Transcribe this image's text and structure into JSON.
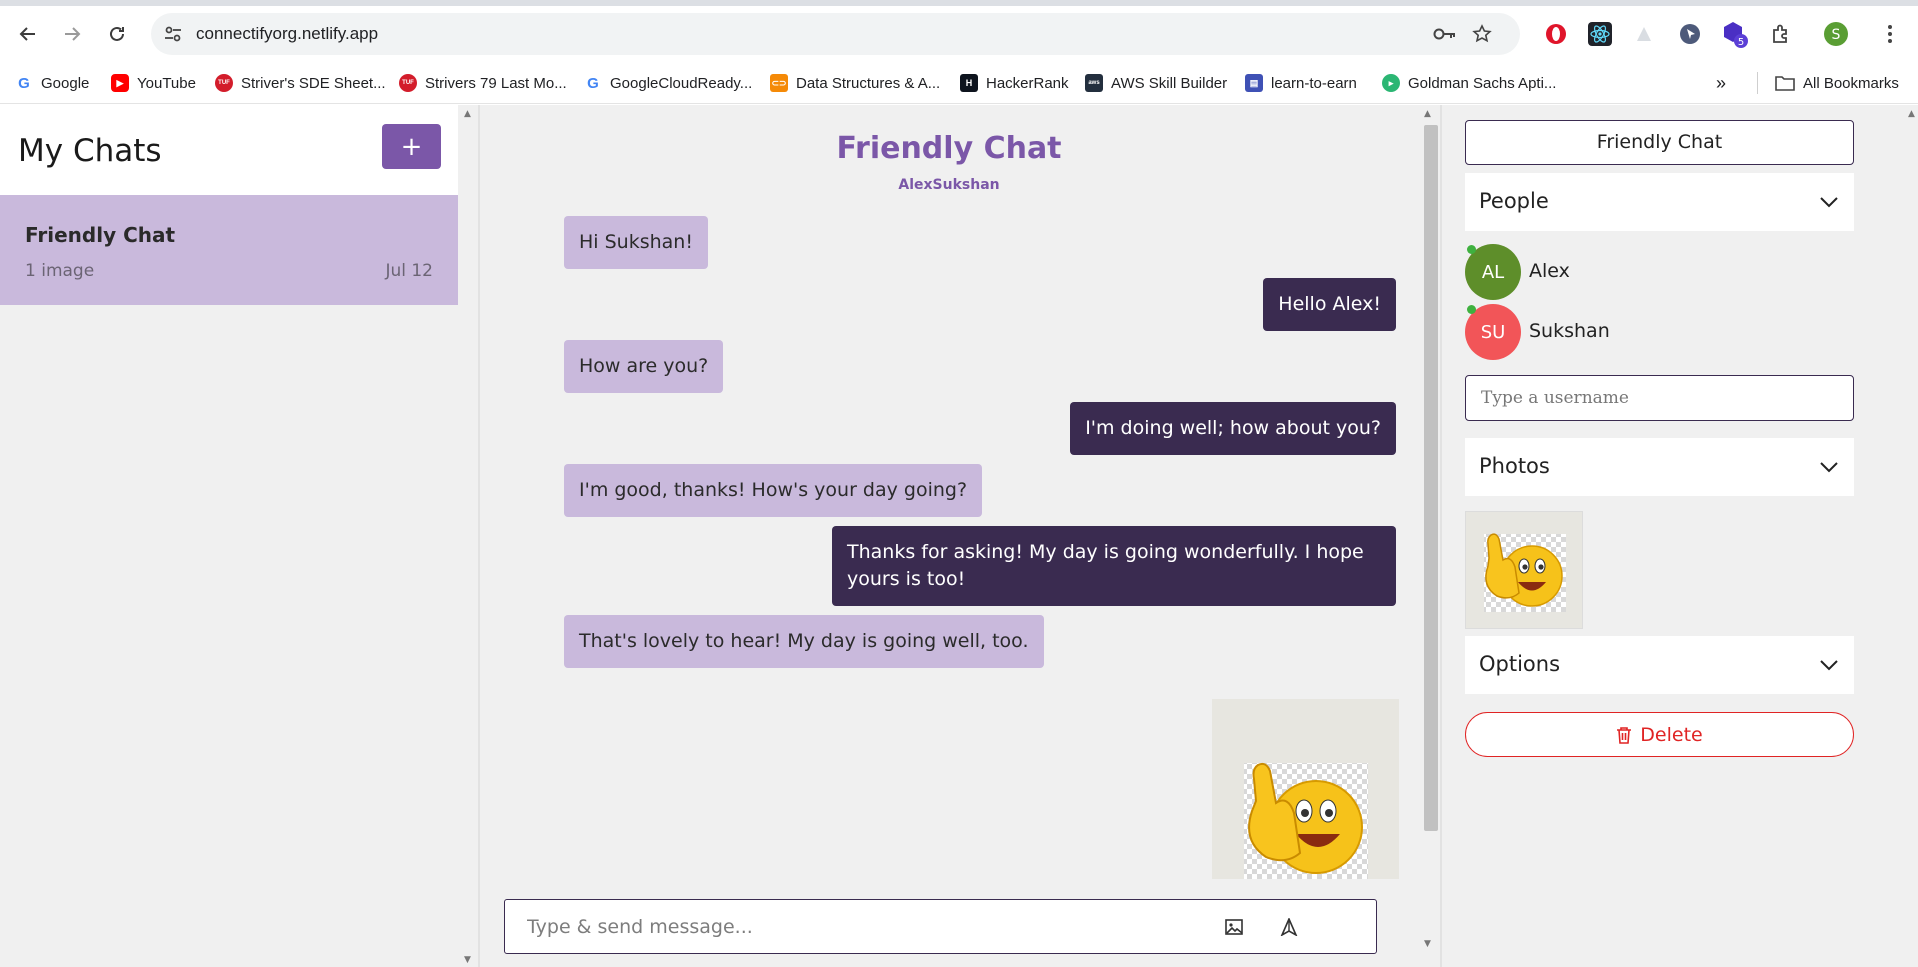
{
  "browser": {
    "url": "connectifyorg.netlify.app",
    "profile_initial": "S",
    "extension_badge": "5",
    "all_bookmarks_label": "All Bookmarks",
    "bookmarks": [
      {
        "label": "Google",
        "icon": "google-icon",
        "color": "#4285f4"
      },
      {
        "label": "YouTube",
        "icon": "youtube-icon",
        "color": "#ff0000"
      },
      {
        "label": "Striver's SDE Sheet...",
        "icon": "tuf-icon",
        "color": "#d31d2b"
      },
      {
        "label": "Strivers 79 Last Mo...",
        "icon": "tuf-icon",
        "color": "#d31d2b"
      },
      {
        "label": "GoogleCloudReady...",
        "icon": "google-icon",
        "color": "#4285f4"
      },
      {
        "label": "Data Structures & A...",
        "icon": "gfg-icon",
        "color": "#f58a07"
      },
      {
        "label": "HackerRank",
        "icon": "hackerrank-icon",
        "color": "#0e141e"
      },
      {
        "label": "AWS Skill Builder",
        "icon": "aws-icon",
        "color": "#232f3e"
      },
      {
        "label": "learn-to-earn",
        "icon": "learn-to-earn-icon",
        "color": "#3f51b5"
      },
      {
        "label": "Goldman Sachs Apti...",
        "icon": "goldman-icon",
        "color": "#2bb673"
      }
    ]
  },
  "sidebar": {
    "title": "My Chats",
    "new_chat_symbol": "+",
    "chats": [
      {
        "name": "Friendly Chat",
        "subtitle": "1 image",
        "date": "Jul 12"
      }
    ]
  },
  "chat": {
    "title": "Friendly Chat",
    "members": "AlexSukshan",
    "messages": [
      {
        "direction": "in",
        "text": "Hi Sukshan!"
      },
      {
        "direction": "out",
        "text": "Hello Alex!"
      },
      {
        "direction": "in",
        "text": "How are you?"
      },
      {
        "direction": "out",
        "text": "I'm doing well; how about you?"
      },
      {
        "direction": "in",
        "text": "I'm good, thanks! How's your day going?"
      },
      {
        "direction": "out",
        "text": "Thanks for asking! My day is going wonderfully. I hope yours is too!"
      },
      {
        "direction": "in",
        "text": "That's lovely to hear! My day is going well, too."
      }
    ],
    "image_message": {
      "direction": "out",
      "content": "thumbs-up-smiley-image"
    },
    "compose": {
      "placeholder": "Type & send message..."
    }
  },
  "details": {
    "title": "Friendly Chat",
    "people_label": "People",
    "people": [
      {
        "initials": "AL",
        "name": "Alex",
        "color": "#5e8e2a",
        "online": true
      },
      {
        "initials": "SU",
        "name": "Sukshan",
        "color": "#f25558",
        "online": true
      }
    ],
    "username_placeholder": "Type a username",
    "photos_label": "Photos",
    "options_label": "Options",
    "delete_label": "Delete"
  },
  "colors": {
    "accent": "#7b57a8",
    "incoming_bubble": "#c9b9dc",
    "outgoing_bubble": "#3a2b50",
    "danger": "#e02424"
  }
}
